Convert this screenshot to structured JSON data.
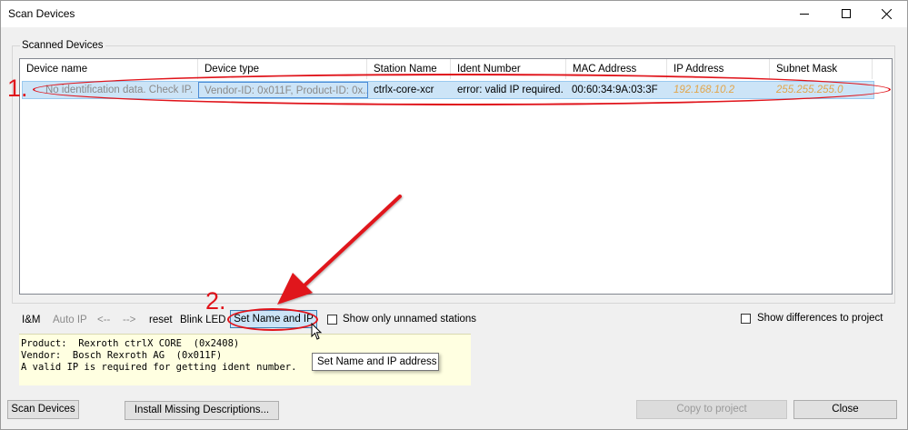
{
  "window": {
    "title": "Scan Devices",
    "controls": {
      "minimize_icon": "minimize-icon",
      "maximize_icon": "maximize-icon",
      "close_icon": "close-icon"
    }
  },
  "group": {
    "label": "Scanned Devices"
  },
  "table": {
    "columns": [
      "Device name",
      "Device type",
      "Station Name",
      "Ident Number",
      "MAC Address",
      "IP Address",
      "Subnet Mask"
    ],
    "rows": [
      {
        "device_name": "No identification data. Check IP.",
        "device_type": "Vendor-ID: 0x011F, Product-ID: 0x...",
        "station_name": "ctrlx-core-xcr",
        "ident_number": "error: valid IP required.",
        "mac_address": "00:60:34:9A:03:3F",
        "ip_address": "192.168.10.2",
        "subnet_mask": "255.255.255.0"
      }
    ]
  },
  "toolbar": {
    "im": "I&M",
    "auto_ip": "Auto IP",
    "prev": "<--",
    "next": "-->",
    "reset": "reset",
    "blink_led": "Blink LED",
    "set_name_ip": "Set Name and IP",
    "show_unnamed": "Show only unnamed stations",
    "show_differences": "Show differences to project"
  },
  "info": {
    "lines": [
      "Product:  Rexroth ctrlX CORE  (0x2408)",
      "Vendor:  Bosch Rexroth AG  (0x011F)",
      "A valid IP is required for getting ident number."
    ]
  },
  "tooltip": {
    "text": "Set Name and IP address"
  },
  "buttons": {
    "scan": "Scan Devices",
    "install": "Install Missing Descriptions...",
    "copy": "Copy to project",
    "close": "Close"
  },
  "annotations": {
    "step1": "1.",
    "step2": "2."
  },
  "colors": {
    "annotation_red": "#e0141b",
    "selection_blue": "#cce4f7",
    "ip_orange": "#e2a54a",
    "info_yellow": "#ffffe1"
  }
}
